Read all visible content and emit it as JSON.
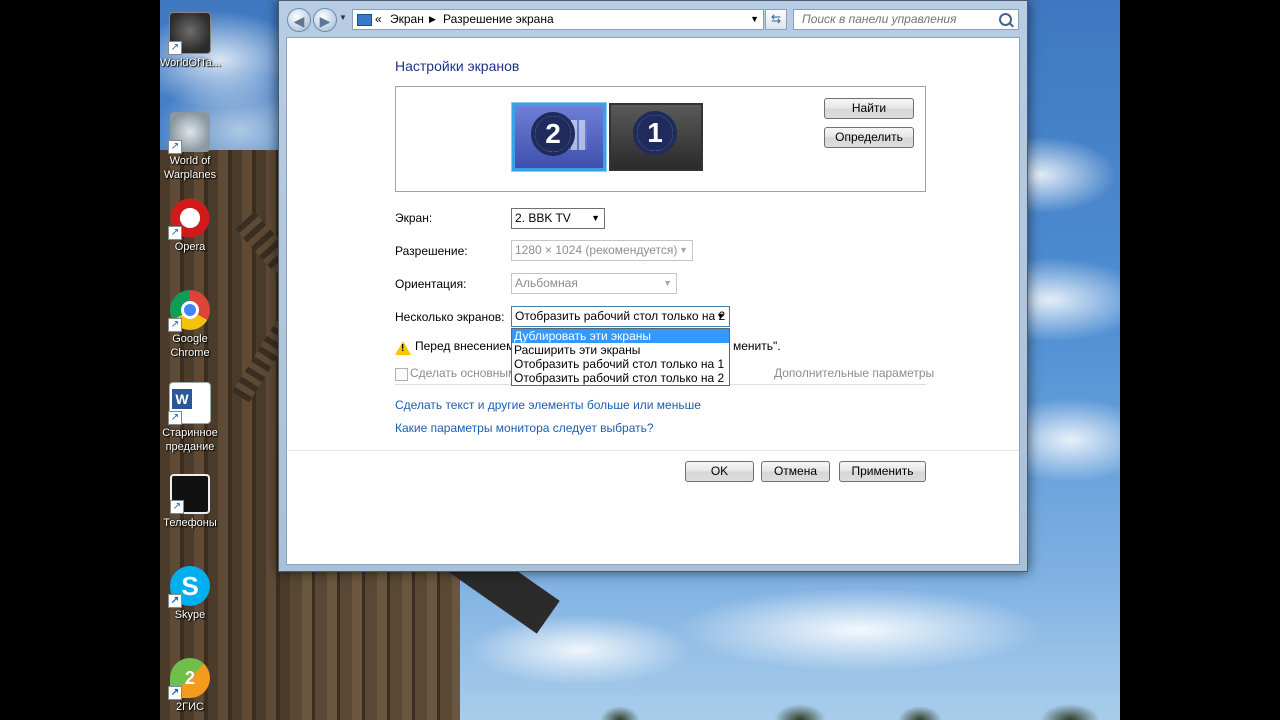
{
  "desktop": {
    "icons": [
      {
        "label": "WorldOfTa...",
        "icon": "world-of-tanks-icon"
      },
      {
        "label": "World of Warplanes",
        "icon": "world-of-warplanes-icon"
      },
      {
        "label": "Opera",
        "icon": "opera-icon"
      },
      {
        "label": "Google Chrome",
        "icon": "chrome-icon"
      },
      {
        "label": "Старинное предание",
        "icon": "word-document-icon"
      },
      {
        "label": "Телефоны",
        "icon": "phones-app-icon"
      },
      {
        "label": "Skype",
        "icon": "skype-icon"
      },
      {
        "label": "2ГИС",
        "icon": "2gis-icon"
      }
    ]
  },
  "window": {
    "address": {
      "chevrons": "«",
      "crumb1": "Экран",
      "crumb2": "Разрешение экрана"
    },
    "search": {
      "placeholder": "Поиск в панели управления"
    },
    "title": "Настройки экранов",
    "monitors": [
      {
        "number": "2",
        "selected": true
      },
      {
        "number": "1",
        "selected": false
      }
    ],
    "buttons": {
      "find": "Найти",
      "identify": "Определить",
      "ok": "OK",
      "cancel": "Отмена",
      "apply": "Применить"
    },
    "fields": {
      "display_label": "Экран:",
      "display_value": "2. BBK TV",
      "resolution_label": "Разрешение:",
      "resolution_value": "1280 × 1024 (рекомендуется)",
      "orientation_label": "Ориентация:",
      "orientation_value": "Альбомная",
      "multi_label": "Несколько экранов:",
      "multi_value": "Отобразить рабочий стол только на 2"
    },
    "multi_options": [
      "Дублировать эти экраны",
      "Расширить эти экраны",
      "Отобразить рабочий стол только на 1",
      "Отобразить рабочий стол только на 2"
    ],
    "highlighted_option": 0,
    "warning_start": "Перед внесением",
    "warning_end": "менить\".",
    "make_main_label": "Сделать основным",
    "advanced_link": "Дополнительные параметры",
    "link_bigger": "Сделать текст и другие элементы больше или меньше",
    "link_which": "Какие параметры монитора следует выбрать?"
  },
  "colors": {
    "title": "#1e3287",
    "link": "#1e5eb1",
    "highlight": "#3399ff",
    "warning": "#f7c600"
  }
}
